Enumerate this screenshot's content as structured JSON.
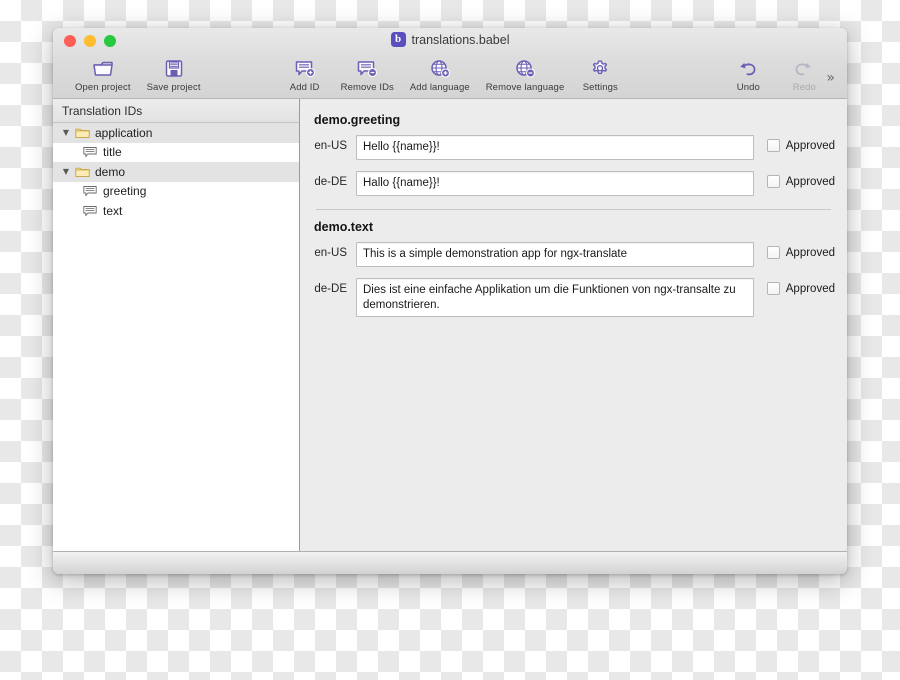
{
  "window": {
    "title": "translations.babel",
    "app_icon": "babel-app-icon",
    "app_icon_letter": "b",
    "accent_color": "#5b4fc0",
    "traffic_lights": [
      {
        "name": "close",
        "color": "#ff5f57"
      },
      {
        "name": "minimize",
        "color": "#febc2e"
      },
      {
        "name": "zoom",
        "color": "#28c840"
      }
    ]
  },
  "toolbar": {
    "overflow_label": "»",
    "groups": [
      {
        "items": [
          {
            "label": "Open project",
            "icon": "open-folder-icon",
            "enabled": true
          },
          {
            "label": "Save project",
            "icon": "floppy-disk-icon",
            "enabled": true
          }
        ]
      },
      {
        "items": [
          {
            "label": "Add ID",
            "icon": "speech-bubble-plus-icon",
            "enabled": true
          },
          {
            "label": "Remove IDs",
            "icon": "speech-bubble-minus-icon",
            "enabled": true
          },
          {
            "label": "Add language",
            "icon": "globe-plus-icon",
            "enabled": true
          },
          {
            "label": "Remove language",
            "icon": "globe-minus-icon",
            "enabled": true
          },
          {
            "label": "Settings",
            "icon": "gear-icon",
            "enabled": true
          }
        ]
      },
      {
        "items": [
          {
            "label": "Undo",
            "icon": "undo-arrow-icon",
            "enabled": true
          },
          {
            "label": "Redo",
            "icon": "redo-arrow-icon",
            "enabled": false
          }
        ]
      }
    ]
  },
  "sidebar": {
    "header": "Translation IDs",
    "tree": [
      {
        "label": "application",
        "type": "group",
        "icon": "folder-icon",
        "expanded": true,
        "disclosure": "▼"
      },
      {
        "label": "title",
        "type": "leaf",
        "icon": "translation-id-icon"
      },
      {
        "label": "demo",
        "type": "group",
        "icon": "folder-icon",
        "expanded": true,
        "disclosure": "▼"
      },
      {
        "label": "greeting",
        "type": "leaf",
        "icon": "translation-id-icon"
      },
      {
        "label": "text",
        "type": "leaf",
        "icon": "translation-id-icon"
      }
    ]
  },
  "content": {
    "approved_label": "Approved",
    "sections": [
      {
        "id": "demo.greeting",
        "rows": [
          {
            "lang": "en-US",
            "value": "Hello {{name}}!",
            "approved": false,
            "lines": 1
          },
          {
            "lang": "de-DE",
            "value": "Hallo {{name}}!",
            "approved": false,
            "lines": 1
          }
        ]
      },
      {
        "id": "demo.text",
        "rows": [
          {
            "lang": "en-US",
            "value": "This is a simple demonstration app for ngx-translate",
            "approved": false,
            "lines": 1
          },
          {
            "lang": "de-DE",
            "value": "Dies ist eine einfache Applikation um die Funktionen von ngx-transalte zu demonstrieren.",
            "approved": false,
            "lines": 2
          }
        ]
      }
    ]
  }
}
